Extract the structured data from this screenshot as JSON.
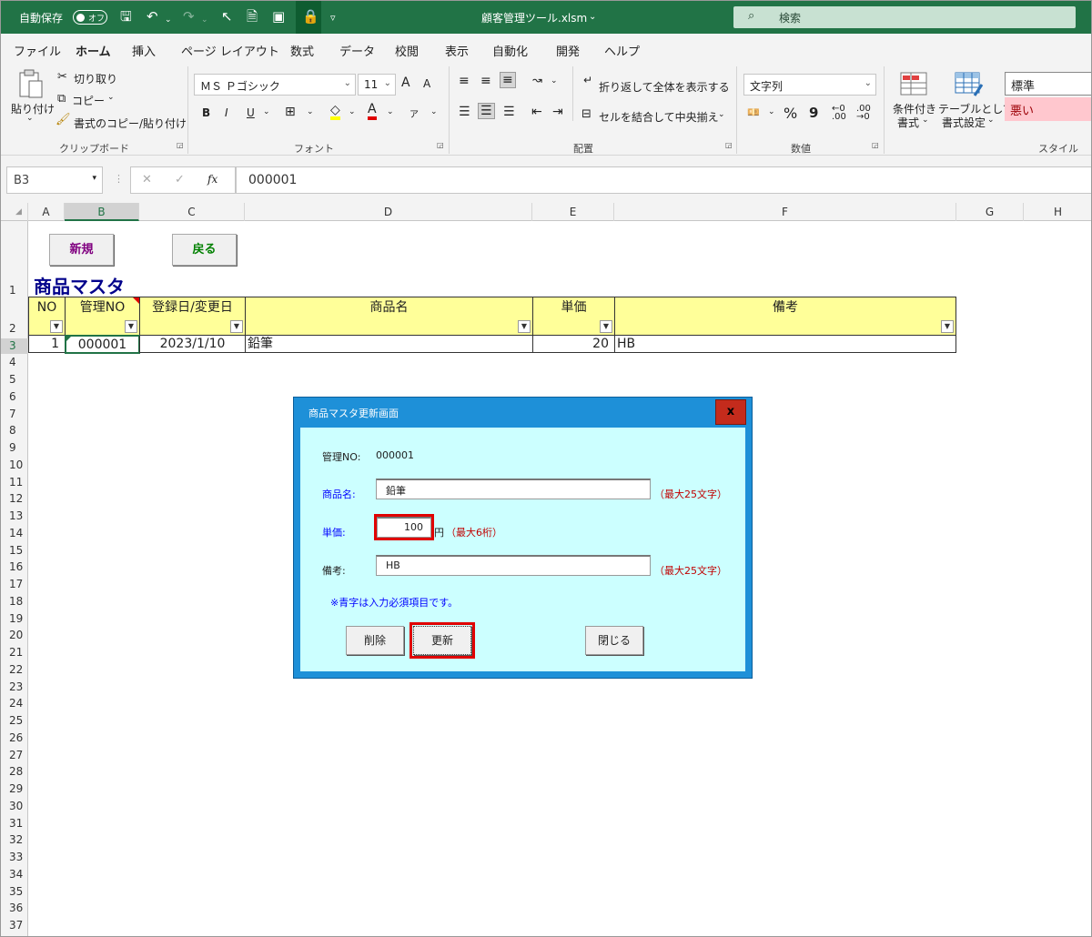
{
  "titlebar": {
    "autosave_label": "自動保存",
    "autosave_state": "オフ",
    "filename": "顧客管理ツール.xlsm",
    "search_placeholder": "検索"
  },
  "menu": {
    "items": [
      "ファイル",
      "ホーム",
      "挿入",
      "ページ レイアウト",
      "数式",
      "データ",
      "校閲",
      "表示",
      "自動化",
      "開発",
      "ヘルプ"
    ],
    "active": "ホーム"
  },
  "ribbon": {
    "clipboard": {
      "paste": "貼り付け",
      "cut": "切り取り",
      "copy": "コピー",
      "format_painter": "書式のコピー/貼り付け",
      "group": "クリップボード"
    },
    "font": {
      "name": "ＭＳ Ｐゴシック",
      "size": "11",
      "group": "フォント",
      "bold": "B",
      "italic": "I",
      "underline": "U",
      "grow": "A",
      "shrink": "A",
      "font_color_letter": "A"
    },
    "alignment": {
      "wrap": "折り返して全体を表示する",
      "merge": "セルを結合して中央揃え",
      "group": "配置"
    },
    "number": {
      "format": "文字列",
      "percent": "%",
      "comma": "9",
      "group": "数値"
    },
    "styles": {
      "conditional_line1": "条件付き",
      "conditional_line2": "書式",
      "table_line1": "テーブルとして",
      "table_line2": "書式設定",
      "normal": "標準",
      "bad": "悪い",
      "group": "スタイル"
    }
  },
  "formula_bar": {
    "name_box": "B3",
    "fx": "fx",
    "cancel": "✕",
    "enter": "✓",
    "value": "000001"
  },
  "columns": [
    "A",
    "B",
    "C",
    "D",
    "E",
    "F",
    "G",
    "H"
  ],
  "selected_column": "B",
  "rows": [
    "1",
    "2",
    "3",
    "4",
    "5",
    "6",
    "7",
    "8",
    "9",
    "10",
    "11",
    "12",
    "13",
    "14",
    "15",
    "16",
    "17",
    "18",
    "19",
    "20",
    "21",
    "22",
    "23",
    "24",
    "25",
    "26",
    "27",
    "28",
    "29",
    "30",
    "31",
    "32",
    "33",
    "34",
    "35",
    "36",
    "37"
  ],
  "selected_row": "3",
  "sheet": {
    "new_button": "新規",
    "back_button": "戻る",
    "title": "商品マスタ",
    "headers": [
      "NO",
      "管理NO",
      "登録日/変更日",
      "商品名",
      "単価",
      "備考"
    ],
    "row": {
      "no": "1",
      "code": "000001",
      "date": "2023/1/10",
      "name": "鉛筆",
      "price": "20",
      "note": "HB"
    }
  },
  "dialog": {
    "title": "商品マスタ更新画面",
    "close": "x",
    "code_label": "管理NO:",
    "code_value": "000001",
    "name_label": "商品名:",
    "name_value": "鉛筆",
    "name_hint": "（最大25文字）",
    "price_label": "単価:",
    "price_value": "100",
    "price_unit": "円",
    "price_hint": "（最大6桁）",
    "note_label": "備考:",
    "note_value": "HB",
    "note_hint": "（最大25文字）",
    "required_note": "※青字は入力必須項目です。",
    "delete_button": "削除",
    "update_button": "更新",
    "close_button": "閉じる"
  },
  "colors": {
    "excel_green": "#217346",
    "header_yellow": "#ffff99",
    "dialog_bg": "#ccffff",
    "dialog_frame": "#1e90d8",
    "highlight": "#e00000"
  }
}
